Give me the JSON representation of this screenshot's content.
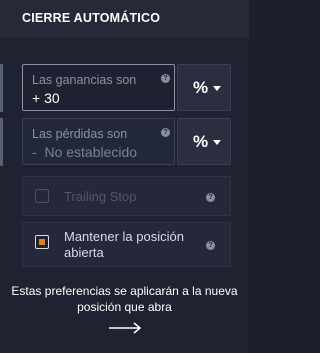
{
  "header": {
    "title": "CIERRE AUTOMÁTICO"
  },
  "take_profit": {
    "label": "Las ganancias son",
    "value": "+ 30",
    "unit": "%",
    "help_icon": "help-icon"
  },
  "stop_loss": {
    "label": "Las pérdidas son",
    "sign": "-",
    "placeholder": "No establecido",
    "unit": "%",
    "help_icon": "help-icon"
  },
  "trailing_stop": {
    "label": "Trailing Stop",
    "checked": false,
    "enabled": false
  },
  "keep_position": {
    "label": "Mantener la posición abierta",
    "checked": true,
    "enabled": true
  },
  "note": {
    "text": "Estas preferencias se aplicarán a la nueva posición que abra"
  },
  "arrow_icon": "arrow-right-icon",
  "colors": {
    "accent": "#e77c1d",
    "background": "#1f2230",
    "header_bg": "#262a38"
  }
}
